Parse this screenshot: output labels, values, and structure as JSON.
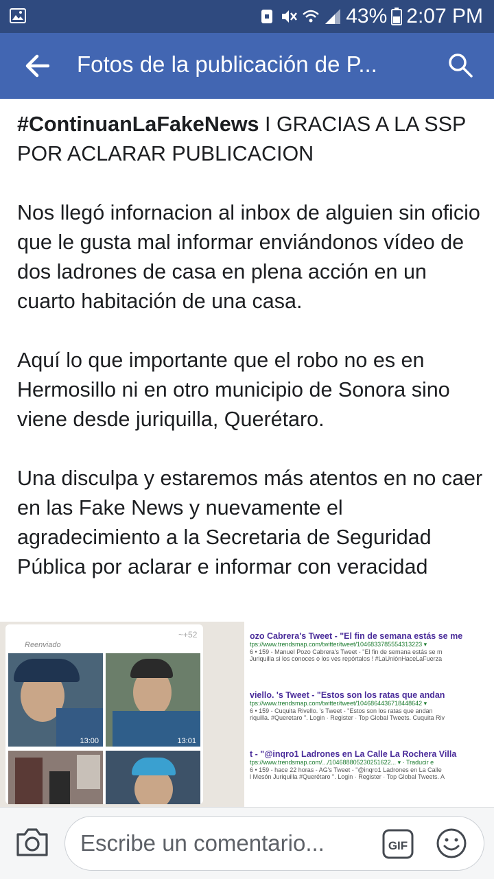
{
  "status_bar": {
    "battery": "43%",
    "time": "2:07 PM"
  },
  "app_bar": {
    "title": "Fotos de la publicación de P..."
  },
  "post": {
    "hashtag": "#ContinuanLaFakeNews",
    "headline_rest": " I GRACIAS A LA SSP POR ACLARAR PUBLICACION",
    "paragraphs": [
      "Nos llegó infornacion al inbox de alguien sin oficio que le gusta mal informar enviándonos vídeo de dos ladrones de casa en plena acción en un cuarto habitación de una casa.",
      "Aquí lo que importante que el robo no es en Hermosillo ni en otro municipio de Sonora sino viene desde juriquilla, Querétaro.",
      "Una disculpa y estaremos más atentos en no caer en las Fake News y nuevamente el agradecimiento a la Secretaria de Seguridad Pública por aclarar e informar con veracidad"
    ]
  },
  "photo": {
    "chat": {
      "forwarded": "Reenviado",
      "count": "~+52",
      "times": [
        "13:00",
        "13:01"
      ]
    },
    "tweets": [
      {
        "head": "ozo Cabrera's Tweet - \"El fin de semana estás se me",
        "url": "tps://www.trendsmap.com/twitter/tweet/1046833785554313223 ▾",
        "snippet": "6 • 159 - Manuel Pozo Cabrera's Tweet - \"El fin de semana estás se m",
        "snippet2": "Juriquilla si los conoces o los ves repórtalos ! #LaUniónHaceLaFuerza"
      },
      {
        "head": "viello. 's Tweet - \"Estos son los ratas que andan",
        "url": "tps://www.trendsmap.com/twitter/tweet/1046864436718448642 ▾",
        "snippet": "6 • 159 - Cuquita Rivello. 's Tweet - \"Estos son los ratas que andan",
        "snippet2": "riquilla. #Queretaro \". Login · Register · Top Global Tweets. Cuquita Riv"
      },
      {
        "head": "t - \"@inqro1 Ladrones en La Calle La Rochera Villa",
        "url": "tps://www.trendsmap.com/.../104688805230251622... ▾ · Traducir e",
        "snippet": "6 • 159 - hace 22 horas - AG's Tweet - \"@inqro1 Ladrones en La Calle",
        "snippet2": "l Mesón Juriquilla #Querétaro \". Login · Register · Top Global Tweets. A"
      }
    ]
  },
  "comment_bar": {
    "placeholder": "Escribe un comentario...",
    "gif_label": "GIF"
  }
}
